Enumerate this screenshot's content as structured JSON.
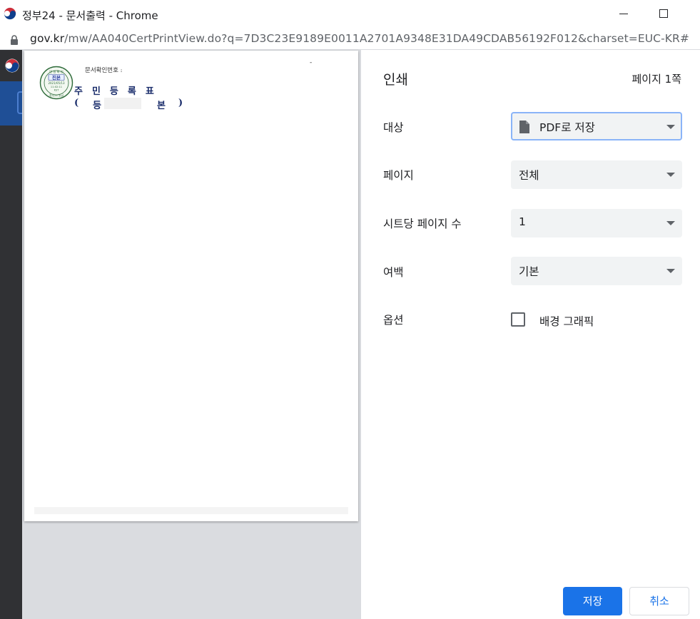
{
  "window": {
    "title": "정부24 - 문서출력 - Chrome",
    "url_host": "gov.kr",
    "url_rest": "/mw/AA040CertPrintView.do?q=7D3C23E9189E0011A2701A9348E31DA49CDAB56192F012&charset=EUC-KR#"
  },
  "document": {
    "confirm_label": "문서확인번호 :",
    "dash": "-",
    "title": "주민등록표",
    "sub_open": "(",
    "sub_left": "등",
    "sub_right": "본",
    "sub_close": ")",
    "seal_top": "민 원 확 인",
    "seal_main": "진본",
    "seal_date": "2021/05/13",
    "seal_time": "11:02:11",
    "seal_tz": "KST",
    "seal_bottom": "정부24 발급"
  },
  "print": {
    "title": "인쇄",
    "page_count": "페이지 1쪽",
    "destination_label": "대상",
    "destination_value": "PDF로 저장",
    "pages_label": "페이지",
    "pages_value": "전체",
    "pages_per_sheet_label": "시트당 페이지 수",
    "pages_per_sheet_value": "1",
    "margins_label": "여백",
    "margins_value": "기본",
    "options_label": "옵션",
    "background_graphics_label": "배경 그래픽",
    "background_graphics_checked": false,
    "save_button": "저장",
    "cancel_button": "취소"
  },
  "colors": {
    "accent": "#1a73e8",
    "select_bg": "#f1f3f4",
    "focus_ring": "#8ab4f8",
    "preview_bg": "#dadce0",
    "doc_ink": "#1a2d6b"
  },
  "icons": {
    "tab_logo": "taegeuk-logo-icon",
    "lock": "lock-icon",
    "destination": "document-icon",
    "dropdown": "caret-down-icon"
  }
}
